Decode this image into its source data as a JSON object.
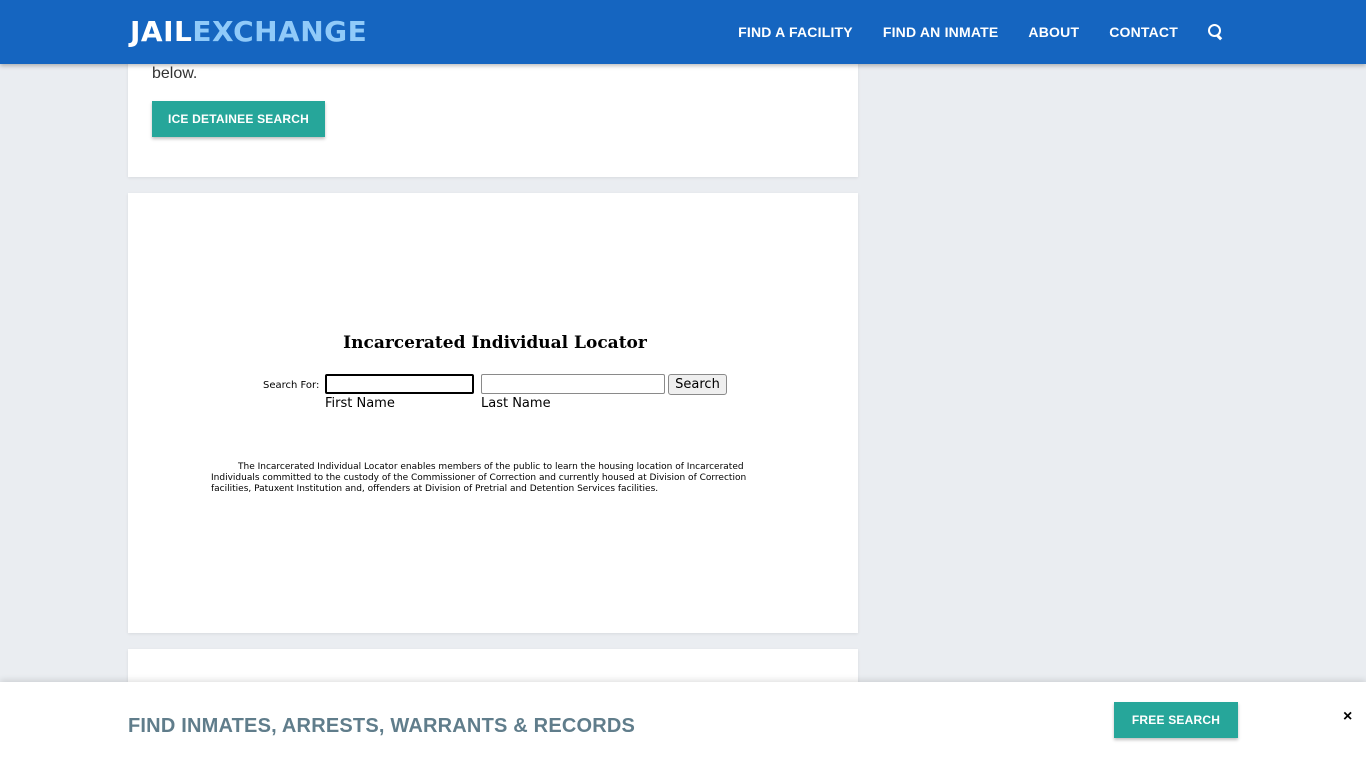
{
  "navbar": {
    "logo_part1": "JAIL",
    "logo_part2": "EXCHANGE",
    "links": [
      "FIND A FACILITY",
      "FIND AN INMATE",
      "ABOUT",
      "CONTACT"
    ],
    "search_icon": "search-icon"
  },
  "card1": {
    "text": "below.",
    "button_label": "ICE DETAINEE SEARCH"
  },
  "locator": {
    "title": "Incarcerated Individual Locator",
    "search_for_label": "Search For:",
    "first_name_value": "",
    "last_name_value": "",
    "search_button": "Search",
    "first_name_label": "First Name",
    "last_name_label": "Last Name",
    "description": "The Incarcerated Individual Locator enables members of the public to learn the housing location of Incarcerated Individuals committed to the custody of the Commissioner of Correction and currently housed at Division of Correction facilities, Patuxent Institution and, offenders at Division of Pretrial and Detention Services facilities."
  },
  "footer": {
    "text": "FIND INMATES, ARRESTS, WARRANTS & RECORDS",
    "button_label": "FREE SEARCH",
    "close_symbol": "×"
  },
  "colors": {
    "navbar": "#1565c0",
    "logo_accent": "#90caf9",
    "button_teal": "#26a69a",
    "footer_text": "#607d8b",
    "page_bg": "#eaedf1"
  }
}
